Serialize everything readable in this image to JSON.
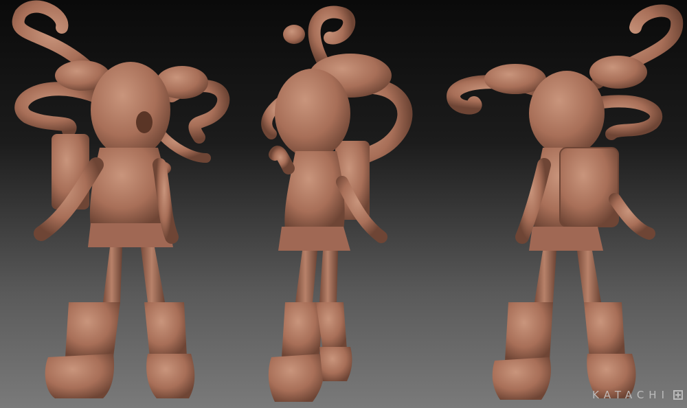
{
  "watermark": {
    "text": "KATACHI"
  },
  "colors": {
    "clay": "#b07a64",
    "clay_shadow": "#6e4535",
    "clay_light": "#c9957c",
    "bg_top": "#0a0a0a",
    "bg_bottom": "#7a7a7a"
  },
  "figures": [
    {
      "view": "front"
    },
    {
      "view": "side"
    },
    {
      "view": "back"
    }
  ]
}
